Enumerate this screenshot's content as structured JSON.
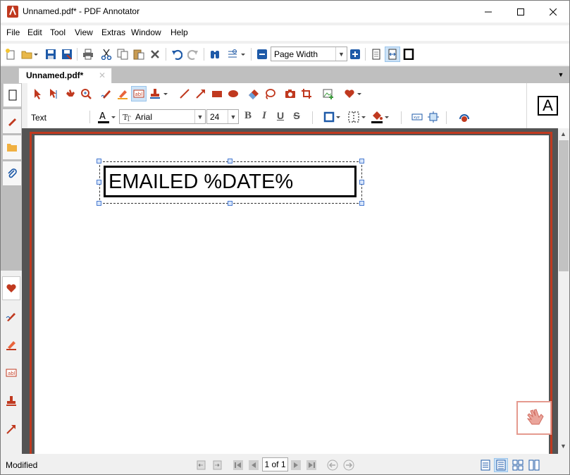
{
  "window": {
    "title": "Unnamed.pdf* - PDF Annotator"
  },
  "menu": [
    "File",
    "Edit",
    "Tool",
    "View",
    "Extras",
    "Window",
    "Help"
  ],
  "toolbar": {
    "zoom_value": "Page Width"
  },
  "tabs": [
    {
      "label": "Unnamed.pdf*",
      "close": "✕"
    }
  ],
  "annotation_toolbar": {
    "tool_label": "Text",
    "font": "Arial",
    "font_size": "24",
    "bold": "B",
    "italic": "I",
    "underline": "U",
    "strike": "S"
  },
  "preview": {
    "glyph": "A"
  },
  "document": {
    "stamp_text": "EMAILED %DATE%"
  },
  "status_bar": {
    "status": "Modified",
    "page_indicator": "1 of 1"
  },
  "colors": {
    "accent_red": "#c0391f",
    "selection_blue": "#cde3f7",
    "icon_blue": "#1e5aa8"
  }
}
